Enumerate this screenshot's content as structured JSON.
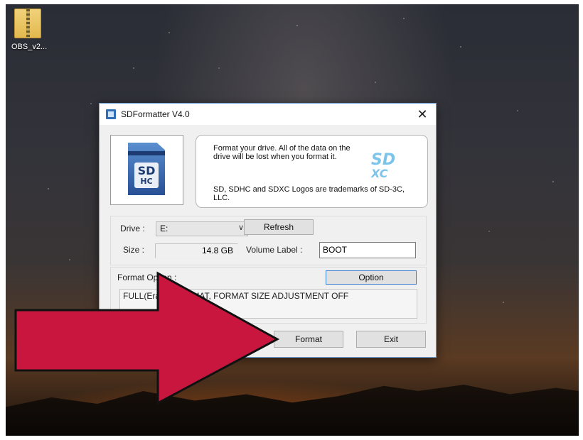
{
  "desktop": {
    "icon_label": "OBS_v2..."
  },
  "dialog": {
    "title": "SDFormatter V4.0",
    "close_glyph": "✕",
    "info_text": "Format your drive. All of the data on the drive will be lost when you format it.",
    "trademark_text": "SD, SDHC and SDXC Logos are trademarks of SD-3C, LLC.",
    "sd_card_logo": {
      "top": "SD",
      "bottom": "HC"
    },
    "sdxc_logo": {
      "top": "SD",
      "bottom": "XC"
    },
    "drive_label": "Drive :",
    "drive_value": "E:",
    "dropdown_glyph": "∨",
    "refresh_label": "Refresh",
    "size_label": "Size :",
    "size_value": "14.8 GB",
    "volume_label_text": "Volume Label :",
    "volume_label_value": "BOOT",
    "format_option_label": "Format Option :",
    "option_button": "Option",
    "format_option_value": "FULL(Erase) FORMAT, FORMAT SIZE ADJUSTMENT OFF",
    "format_button": "Format",
    "exit_button": "Exit"
  },
  "colors": {
    "arrow_fill": "#c8163f",
    "arrow_stroke": "#111111",
    "option_button_border": "#3b7fd0"
  }
}
